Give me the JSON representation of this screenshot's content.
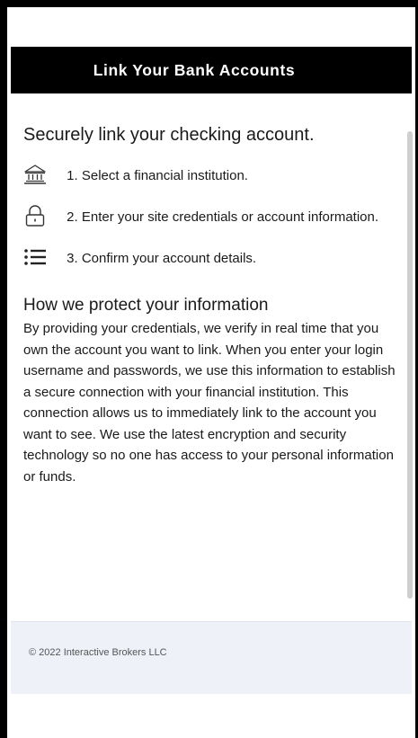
{
  "header": {
    "title": "Link Your Bank Accounts"
  },
  "main": {
    "subtitle": "Securely link your checking account.",
    "steps": [
      {
        "icon": "bank-icon",
        "label": "1. Select a financial institution."
      },
      {
        "icon": "lock-icon",
        "label": "2. Enter your site credentials or account information."
      },
      {
        "icon": "list-icon",
        "label": "3. Confirm your account details."
      }
    ],
    "protect_title": "How we protect your information",
    "protect_body": "By providing your credentials, we verify in real time that you own the account you want to link. When you enter your login username and passwords, we use this information to establish a secure connection with your financial institution. This connection allows us to immediately link to the account you want to see. We use the latest encryption and security technology so no one has access to your personal information or funds."
  },
  "footer": {
    "copyright": "© 2022 Interactive Brokers LLC"
  },
  "colors": {
    "header_bg": "#000000",
    "header_text": "#ffffff",
    "footer_bg": "#eef1f8"
  }
}
